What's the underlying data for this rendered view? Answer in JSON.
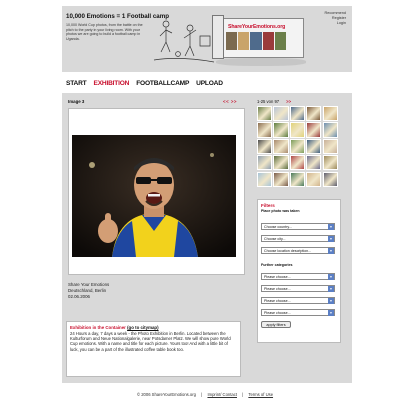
{
  "header": {
    "title": "10,000 Emotions = 1 Football camp",
    "intro": "10,000 World Cup photos, from the battle on the pitch to the party in your living room. With your photos we are going to build a football camp in Uganda.",
    "container_brand": "ShareYourEmotions.org",
    "top_links": [
      "Recommend",
      "Register",
      "Login"
    ]
  },
  "nav": {
    "items": [
      "START",
      "EXHIBITION",
      "FOOTBALLCAMP",
      "UPLOAD"
    ],
    "active": "EXHIBITION"
  },
  "viewer": {
    "image_label": "Image 3",
    "prev_next": "<< >>",
    "caption_lines": [
      "Share Your Emotions",
      "Deutschland, Berlin",
      "02.06.2006"
    ]
  },
  "exhibition_info": {
    "title": "Exhibition in the Container",
    "link": "(go to citymap)",
    "text": "24 Hours a day, 7 days a week - the Photo Exhibition in Berlin. Located between the Kulturforum and Neue Nationalgalerie, near Potsdamer Platz. We will show pure World Cup emotions. With a name and title for each picture. Yours too! And with a little bit of luck, you can be a part of the illustrated coffee table book too."
  },
  "thumbnails": {
    "range_label": "1-25 von 97",
    "arrows": ">>",
    "colors": [
      "#6b7f4a",
      "#b8c3d6",
      "#4f6b8c",
      "#7b5a3a",
      "#c9a46a",
      "#8a6d50",
      "#5d7d3f",
      "#e0d27a",
      "#9a3b3b",
      "#6c8fb0",
      "#4b4b4b",
      "#a88a6e",
      "#7d9d5b",
      "#3f5f7f",
      "#c7b09a",
      "#8f9faf",
      "#5c6e3e",
      "#b04848",
      "#6e6e8e",
      "#9c8a5c",
      "#a7c4d8",
      "#7a5c4a",
      "#4a7a5a",
      "#d1b48c",
      "#5e5e6e"
    ]
  },
  "filters": {
    "title": "Filters",
    "subtitle": "Place photo was taken",
    "country_select": "Choose country...",
    "city_select": "Choose city...",
    "location_select": "Choose location description...",
    "further_label": "Further categories",
    "category_selects": [
      "Please choose...",
      "Please choose...",
      "Please choose...",
      "Please choose..."
    ],
    "apply_label": "apply filters"
  },
  "footer": {
    "copyright": "© 2006 ShareYourEmotions.org",
    "links": [
      "Imprint/ Contact",
      "Terms of Use"
    ],
    "separator": "|"
  },
  "colors": {
    "accent": "#c8102e",
    "panel": "#d9d9d9",
    "select_arrow": "#5b7fc4"
  }
}
